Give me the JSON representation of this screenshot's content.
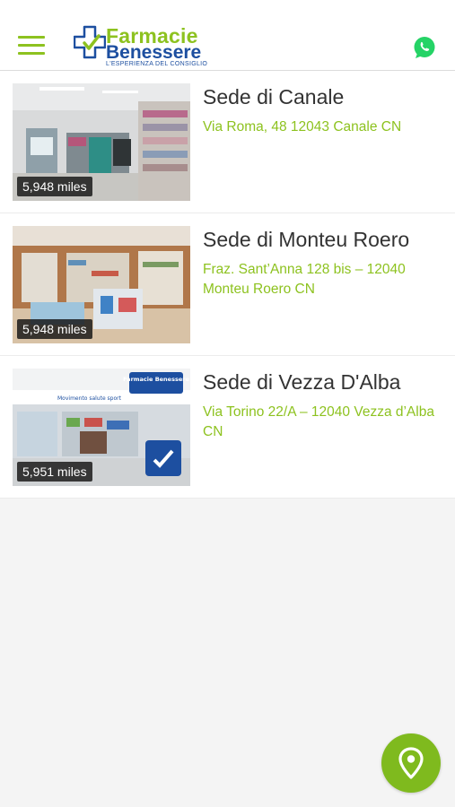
{
  "header": {
    "brand_line1": "Farmacie",
    "brand_line2": "Benessere",
    "brand_tagline": "L'ESPERIENZA DEL CONSIGLIO"
  },
  "stores": [
    {
      "name": "Sede di Canale",
      "address": "Via Roma, 48 12043 Canale CN",
      "distance": "5,948 miles"
    },
    {
      "name": "Sede di Monteu Roero",
      "address": "Fraz. Sant’Anna 128 bis – 12040 Monteu Roero CN",
      "distance": "5,948 miles"
    },
    {
      "name": "Sede di Vezza D'Alba",
      "address": "Via Torino 22/A – 12040 Vezza d’Alba CN",
      "distance": "5,951 miles",
      "photo_sign": "Farmacie Benessere",
      "photo_banner": "Movimento salute sport"
    }
  ],
  "colors": {
    "accent_green": "#8dc21f",
    "brand_blue": "#1d4fa0",
    "fab_green": "#7fba1e",
    "whatsapp_green": "#25d366"
  },
  "icons": {
    "menu": "hamburger-icon",
    "whatsapp": "whatsapp-icon",
    "map": "map-pin-icon"
  }
}
